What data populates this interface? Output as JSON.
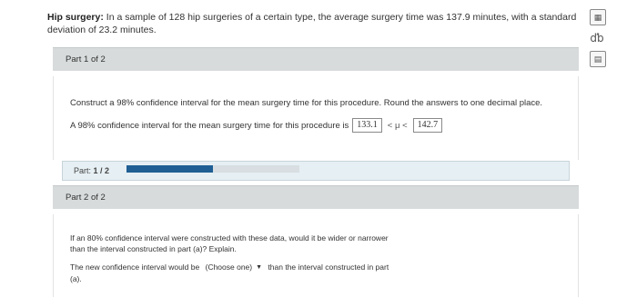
{
  "problem": {
    "title": "Hip surgery:",
    "text_line1": "In a sample of 128 hip surgeries of a certain type, the average surgery time was 137.9 minutes, with a standard",
    "text_line2": "deviation of 23.2 minutes."
  },
  "tools": [
    "table-icon",
    "dlo-icon",
    "calculator-icon"
  ],
  "part1": {
    "header": "Part 1 of 2",
    "question": "Construct a 98% confidence interval for the mean surgery time for this procedure. Round the answers to one decimal place.",
    "answer_prefix": "A 98% confidence interval for the mean surgery time for this procedure is",
    "lower": "133.1",
    "middle": "< μ <",
    "upper": "142.7"
  },
  "progress": {
    "label": "Part:",
    "value": "1 / 2",
    "fraction": 0.5
  },
  "part2": {
    "header": "Part 2 of 2",
    "question_line1": "If an 80% confidence interval were constructed with these data, would it be wider or narrower",
    "question_line2": "than the interval constructed in part (a)? Explain.",
    "answer_prefix": "The new confidence interval would be",
    "select_value": "(Choose one)",
    "answer_suffix": "than the interval constructed in part",
    "answer_suffix_line2": "(a)."
  }
}
